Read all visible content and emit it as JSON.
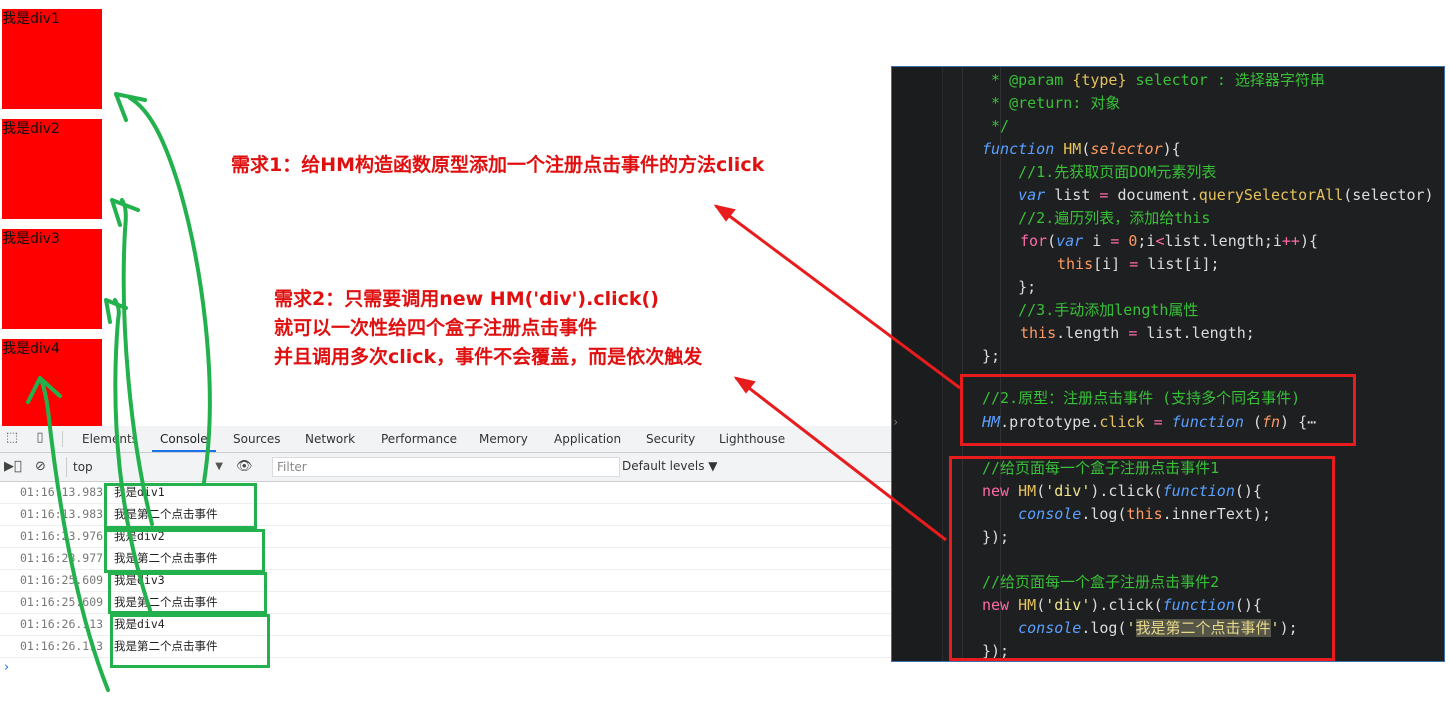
{
  "boxes": [
    {
      "label": "我是div1"
    },
    {
      "label": "我是div2"
    },
    {
      "label": "我是div3"
    },
    {
      "label": "我是div4"
    }
  ],
  "annotations": {
    "req1": "需求1：给HM构造函数原型添加一个注册点击事件的方法click",
    "req2_line1": "需求2：只需要调用new HM('div').click()",
    "req2_line2": "就可以一次性给四个盒子注册点击事件",
    "req2_line3": "并且调用多次click，事件不会覆盖，而是依次触发"
  },
  "devtools": {
    "tabs": [
      "Elements",
      "Console",
      "Sources",
      "Network",
      "Performance",
      "Memory",
      "Application",
      "Security",
      "Lighthouse"
    ],
    "active_tab": "Console",
    "context": "top",
    "filter_placeholder": "Filter",
    "levels": "Default levels",
    "logs": [
      {
        "time": "01:16:13.983",
        "message": "我是div1"
      },
      {
        "time": "01:16:13.983",
        "message": "我是第二个点击事件"
      },
      {
        "time": "01:16:23.976",
        "message": "我是div2"
      },
      {
        "time": "01:16:23.977",
        "message": "我是第二个点击事件"
      },
      {
        "time": "01:16:25.609",
        "message": "我是div3"
      },
      {
        "time": "01:16:25.609",
        "message": "我是第二个点击事件"
      },
      {
        "time": "01:16:26.113",
        "message": "我是div4"
      },
      {
        "time": "01:16:26.113",
        "message": "我是第二个点击事件"
      }
    ],
    "prompt": "›"
  },
  "code": {
    "l1": {
      "a": " * @param ",
      "b": "{type}",
      "c": " selector ",
      "d": ": 选择器字符串"
    },
    "l2": {
      "a": " * @return",
      "b": ": 对象"
    },
    "l3": " */",
    "l4": {
      "kw": "function",
      "name": "HM",
      "p1": "(",
      "param": "selector",
      "p2": "){"
    },
    "l5": "    //1.先获取页面DOM元素列表",
    "l6": {
      "kw": "    var",
      "v": " list ",
      "op": "=",
      "obj": " document.",
      "m": "querySelectorAll",
      "rest": "(selector)"
    },
    "l7": "    //2.遍历列表，添加给this",
    "l8": {
      "kw": "for",
      "p": "(",
      "kw2": "var",
      "a": " i ",
      "op": "=",
      "num": " 0",
      "b": ";i",
      "op2": "<",
      "c": "list.length;i",
      "op3": "++",
      "d": "){"
    },
    "l9": {
      "this": "this",
      "rest": "[i] ",
      "op": "=",
      "rest2": " list[i];"
    },
    "l10": "    };",
    "l11": "    //3.手动添加length属性",
    "l12": {
      "this": "this",
      "rest": ".length ",
      "op": "=",
      "rest2": " list.length;"
    },
    "l13": "};",
    "l14": "//2.原型：注册点击事件 (支持多个同名事件)",
    "l15": {
      "name": "HM",
      "a": ".prototype.",
      "m": "click",
      "op": " = ",
      "kw": "function",
      "sp": " (",
      "param": "fn",
      "end": ") {⋯"
    },
    "l16": "//给页面每一个盒子注册点击事件1",
    "l17": {
      "kw": "new",
      "name": " HM",
      "a": "(",
      "str": "'div'",
      "b": ").click(",
      "kw2": "function",
      "c": "(){"
    },
    "l18": {
      "a": "    ",
      "kw": "console",
      "b": ".log(",
      "this": "this",
      "c": ".innerText);"
    },
    "l19": "});",
    "l20": "//给页面每一个盒子注册点击事件2",
    "l21": {
      "kw": "new",
      "name": " HM",
      "a": "(",
      "str": "'div'",
      "b": ").click(",
      "kw2": "function",
      "c": "(){"
    },
    "l22": {
      "a": "    ",
      "kw": "console",
      "b": ".log(",
      "q1": "'",
      "hl": "我是第二个点击事件",
      "q2": "'",
      "c": ");"
    },
    "l23": "});"
  },
  "colors": {
    "box_red": "#ff0000",
    "annotation_red": "#e01010",
    "highlight_green": "#23b14d",
    "editor_bg": "#1e1f20"
  }
}
